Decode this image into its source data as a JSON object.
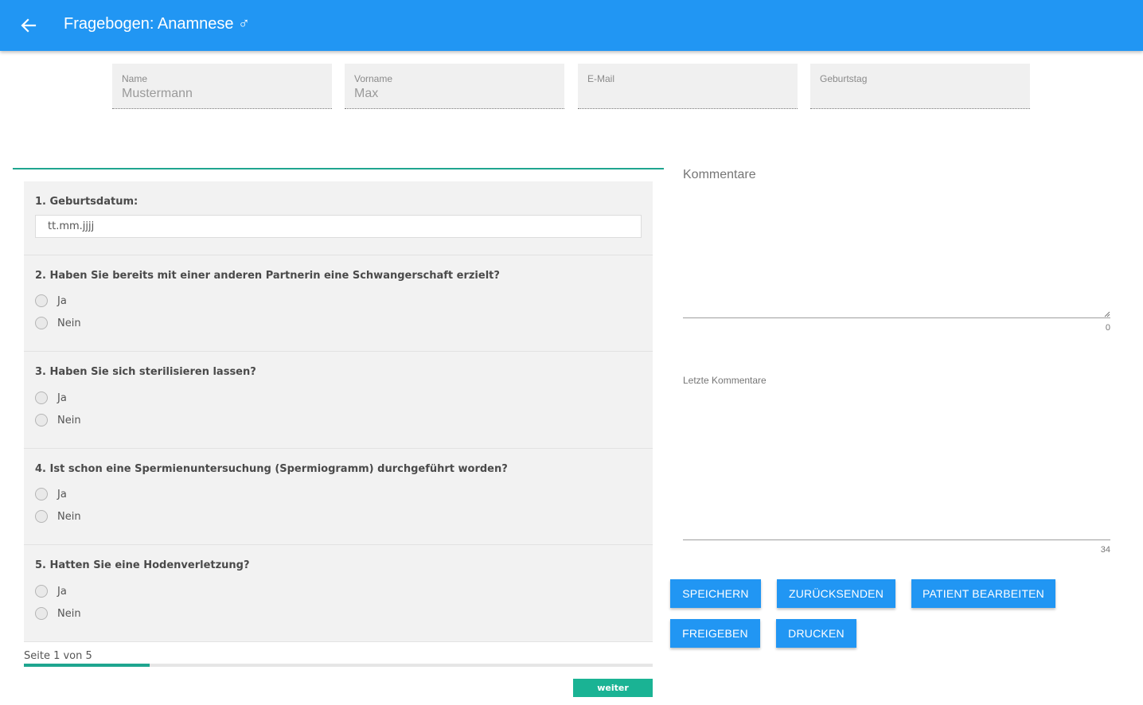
{
  "header": {
    "title": "Fragebogen: Anamnese ♂",
    "back_icon": "arrow-left-icon",
    "bar_color": "#2196f3"
  },
  "patient": {
    "fields": [
      {
        "label": "Name",
        "value": "Mustermann"
      },
      {
        "label": "Vorname",
        "value": "Max"
      },
      {
        "label": "E-Mail",
        "value": ""
      },
      {
        "label": "Geburtstag",
        "value": ""
      }
    ]
  },
  "survey": {
    "accent_color": "#1fa58f",
    "questions": [
      {
        "title": "1. Geburtsdatum:",
        "type": "date",
        "placeholder": "tt.mm.jjjj"
      },
      {
        "title": "2. Haben Sie bereits mit einer anderen Partnerin eine Schwangerschaft erzielt?",
        "options": [
          "Ja",
          "Nein"
        ]
      },
      {
        "title": "3. Haben Sie sich sterilisieren lassen?",
        "options": [
          "Ja",
          "Nein"
        ]
      },
      {
        "title": "4. Ist schon eine Spermienuntersuchung (Spermiogramm) durchgeführt worden?",
        "options": [
          "Ja",
          "Nein"
        ]
      },
      {
        "title": "5. Hatten Sie eine Hodenverletzung?",
        "options": [
          "Ja",
          "Nein"
        ]
      }
    ],
    "page_indicator": "Seite 1 von 5",
    "progress_fraction": 0.2,
    "next_label": "weiter"
  },
  "comments": {
    "label": "Kommentare",
    "value": "",
    "count": "0",
    "last_label": "Letzte Kommentare",
    "last_count": "34"
  },
  "actions": {
    "save": "SPEICHERN",
    "return": "ZURÜCKSENDEN",
    "edit_patient": "PATIENT BEARBEITEN",
    "release": "FREIGEBEN",
    "print": "DRUCKEN"
  }
}
